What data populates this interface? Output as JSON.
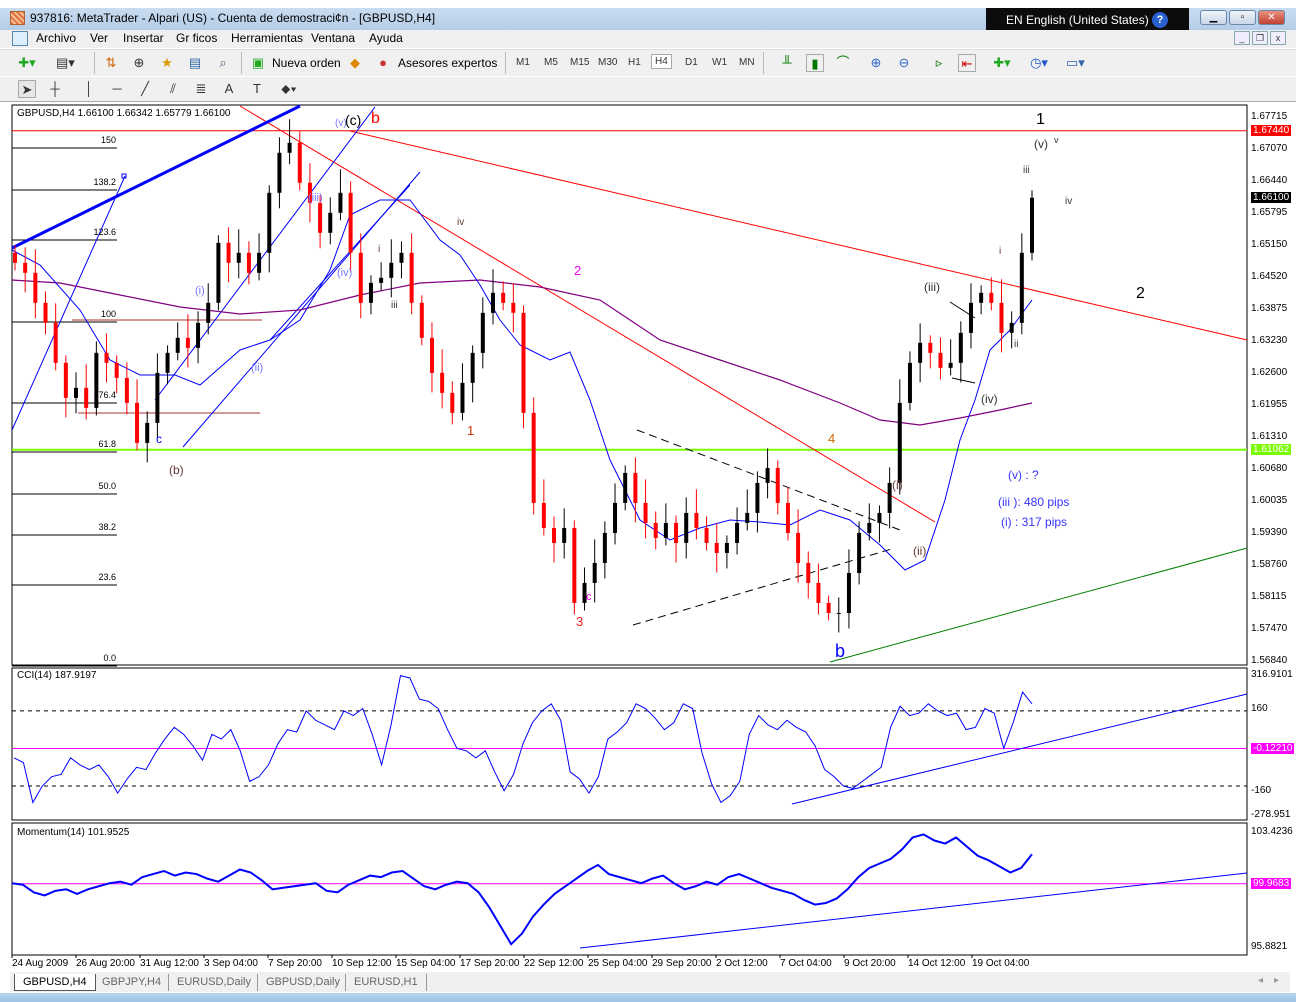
{
  "window": {
    "title": "937816: MetaTrader - Alpari (US) - Cuenta de demostraci¢n - [GBPUSD,H4]",
    "language": "EN English (United States)",
    "help": "?"
  },
  "menu": [
    "Archivo",
    "Ver",
    "Insertar",
    "Gr ficos",
    "Herramientas",
    "Ventana",
    "Ayuda"
  ],
  "toolbar": {
    "new_order": "Nueva orden",
    "experts": "Asesores expertos",
    "timeframes": [
      "M1",
      "M5",
      "M15",
      "M30",
      "H1",
      "H4",
      "D1",
      "W1",
      "MN"
    ],
    "selected_timeframe": "H4"
  },
  "chart": {
    "header": "GBPUSD,H4  1.66100 1.66342 1.65779 1.66100",
    "price_ticks": [
      "1.67715",
      "1.67070",
      "1.66440",
      "1.65795",
      "1.65150",
      "1.64520",
      "1.63875",
      "1.63230",
      "1.62600",
      "1.61955",
      "1.61310",
      "1.60680",
      "1.60035",
      "1.59390",
      "1.58760",
      "1.58115",
      "1.57470",
      "1.56840"
    ],
    "price_scale": {
      "max": 1.67715,
      "min": 1.5684
    },
    "current_price": "1.66100",
    "red_level": "1.67440",
    "green_level": "1.61062",
    "fib_levels": [
      "150",
      "138.2",
      "123.6",
      "100",
      "76.4",
      "61.8",
      "50.0",
      "38.2",
      "23.6",
      "0.0"
    ],
    "wave_labels": [
      "(c)",
      "b",
      "(v)",
      "(iii)",
      "(iv)",
      "(i)",
      "(ii)",
      "c",
      "(b)",
      "iv",
      "i",
      "iii",
      "1",
      "2",
      "3",
      "c",
      "4",
      "b",
      "(i)",
      "(ii)",
      "(iii)",
      "(iv)",
      "i",
      "ii",
      "iii",
      "(v)",
      "v",
      "iv",
      "1",
      "2"
    ],
    "notes": [
      "(v) : ?",
      "(iii ): 480 pips",
      "(i) : 317 pips"
    ],
    "closes": [
      1.648,
      1.646,
      1.64,
      1.636,
      1.628,
      1.621,
      1.623,
      1.619,
      1.63,
      1.628,
      1.625,
      1.62,
      1.612,
      1.616,
      1.626,
      1.63,
      1.633,
      1.631,
      1.636,
      1.64,
      1.652,
      1.648,
      1.65,
      1.646,
      1.65,
      1.662,
      1.67,
      1.672,
      1.664,
      1.66,
      1.654,
      1.658,
      1.662,
      1.65,
      1.64,
      1.644,
      1.645,
      1.648,
      1.65,
      1.64,
      1.633,
      1.626,
      1.622,
      1.618,
      1.624,
      1.63,
      1.638,
      1.642,
      1.64,
      1.638,
      1.618,
      1.6,
      1.595,
      1.592,
      1.595,
      1.58,
      1.584,
      1.588,
      1.594,
      1.6,
      1.606,
      1.6,
      1.596,
      1.593,
      1.596,
      1.592,
      1.598,
      1.595,
      1.592,
      1.59,
      1.592,
      1.596,
      1.598,
      1.604,
      1.607,
      1.6,
      1.594,
      1.588,
      1.584,
      1.58,
      1.578,
      1.578,
      1.586,
      1.594,
      1.596,
      1.598,
      1.604,
      1.62,
      1.628,
      1.632,
      1.63,
      1.627,
      1.628,
      1.634,
      1.64,
      1.642,
      1.64,
      1.634,
      1.636,
      1.65,
      1.661
    ]
  },
  "cci": {
    "label": "CCI(14) 187.9197",
    "ticks": [
      "316.9101",
      "160",
      "-0.12210",
      "-160",
      "-278.951"
    ],
    "scale": {
      "max": 316.91,
      "min": -278.951
    },
    "values": [
      -40,
      -60,
      -230,
      -160,
      -120,
      -110,
      -40,
      -70,
      -90,
      -70,
      -120,
      -190,
      -130,
      -80,
      -90,
      -20,
      40,
      90,
      60,
      10,
      -50,
      60,
      40,
      80,
      -10,
      -140,
      -120,
      -70,
      20,
      80,
      70,
      160,
      120,
      100,
      80,
      160,
      140,
      170,
      60,
      -70,
      100,
      310,
      300,
      210,
      200,
      170,
      80,
      0,
      -10,
      -40,
      -10,
      -100,
      -180,
      -110,
      20,
      110,
      160,
      190,
      120,
      -100,
      -130,
      -190,
      -120,
      40,
      70,
      110,
      190,
      170,
      130,
      80,
      110,
      190,
      170,
      -20,
      -150,
      -230,
      -200,
      -140,
      60,
      140,
      100,
      80,
      120,
      90,
      70,
      10,
      -90,
      -120,
      -160,
      -170,
      -140,
      -110,
      -80,
      90,
      180,
      140,
      150,
      190,
      160,
      140,
      150,
      80,
      90,
      170,
      150,
      0,
      110,
      240,
      190
    ]
  },
  "momentum": {
    "label": "Momentum(14) 101.9525",
    "ticks": [
      "103.4236",
      "99.9683",
      "95.8821"
    ],
    "scale": {
      "max": 103.4236,
      "min": 95.8821
    },
    "values": [
      100.0,
      99.9,
      99.4,
      99.2,
      99.5,
      99.6,
      99.3,
      99.6,
      99.8,
      100.0,
      100.1,
      99.9,
      100.4,
      100.6,
      100.8,
      100.5,
      100.7,
      100.6,
      100.3,
      100.1,
      100.5,
      100.9,
      100.7,
      100.2,
      99.6,
      99.7,
      99.8,
      99.9,
      100.0,
      99.5,
      99.4,
      99.9,
      100.2,
      100.5,
      100.4,
      100.7,
      100.8,
      100.3,
      99.8,
      99.6,
      99.9,
      100.1,
      100.0,
      99.4,
      98.4,
      97.2,
      96.0,
      96.7,
      97.8,
      98.6,
      99.3,
      99.8,
      100.3,
      100.8,
      101.2,
      100.6,
      100.4,
      100.2,
      100.0,
      100.3,
      100.5,
      100.0,
      99.6,
      99.8,
      100.1,
      99.9,
      100.4,
      100.6,
      100.3,
      100.0,
      99.7,
      99.5,
      99.3,
      98.9,
      98.6,
      98.7,
      99.0,
      99.6,
      100.4,
      101.0,
      101.3,
      101.6,
      102.2,
      103.0,
      103.2,
      102.8,
      102.6,
      103.0,
      102.4,
      101.8,
      101.5,
      101.1,
      100.7,
      101.0,
      101.9
    ]
  },
  "time_ticks": [
    "24 Aug 2009",
    "26 Aug 20:00",
    "31 Aug 12:00",
    "3 Sep 04:00",
    "7 Sep 20:00",
    "10 Sep 12:00",
    "15 Sep 04:00",
    "17 Sep 20:00",
    "22 Sep 12:00",
    "25 Sep 04:00",
    "29 Sep 20:00",
    "2 Oct 12:00",
    "7 Oct 04:00",
    "9 Oct 20:00",
    "14 Oct 12:00",
    "19 Oct 04:00"
  ],
  "tabs": [
    "GBPUSD,H4",
    "GBPJPY,H4",
    "EURUSD,Daily",
    "GBPUSD,Daily",
    "EURUSD,H1"
  ],
  "colors": {
    "bull": "#000000",
    "bear": "#ff0000",
    "red_line": "#ff0000",
    "green_line": "#7cfc00",
    "cci_line": "#0000ff",
    "zero_line": "#ff00ff",
    "ma_fast": "#0000ff",
    "ma_slow": "#800080"
  }
}
